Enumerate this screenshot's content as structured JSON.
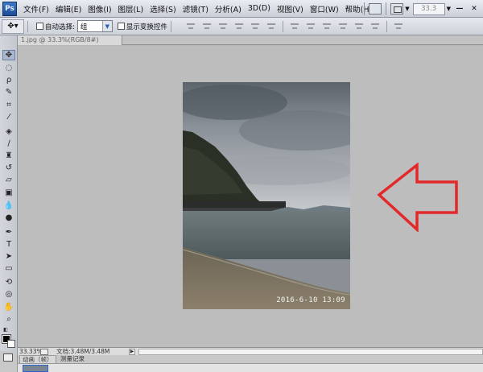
{
  "app": {
    "logo": "Ps"
  },
  "menu": [
    "文件(F)",
    "编辑(E)",
    "图像(I)",
    "图层(L)",
    "选择(S)",
    "滤镜(T)",
    "分析(A)",
    "3D(D)",
    "视图(V)",
    "窗口(W)",
    "帮助(H)"
  ],
  "menubar_right": {
    "zoom": "33.3"
  },
  "options": {
    "auto_select_label": "自动选择:",
    "auto_select_value": "组",
    "show_transform_label": "显示变换控件"
  },
  "document": {
    "tab_title": "1.jpg @ 33.3%(RGB/8#)"
  },
  "photo": {
    "timestamp": "2016-6-10 13:09"
  },
  "status": {
    "zoom": "33.33%",
    "doc_info": "文档:3.48M/3.48M"
  },
  "bottom_panel": {
    "tabs": [
      "动画（帧）",
      "测量记录"
    ]
  },
  "colors": {
    "arrow": "#e3282a",
    "canvas": "#bdbdbd",
    "photoshop_blue": "#1c4c97"
  }
}
